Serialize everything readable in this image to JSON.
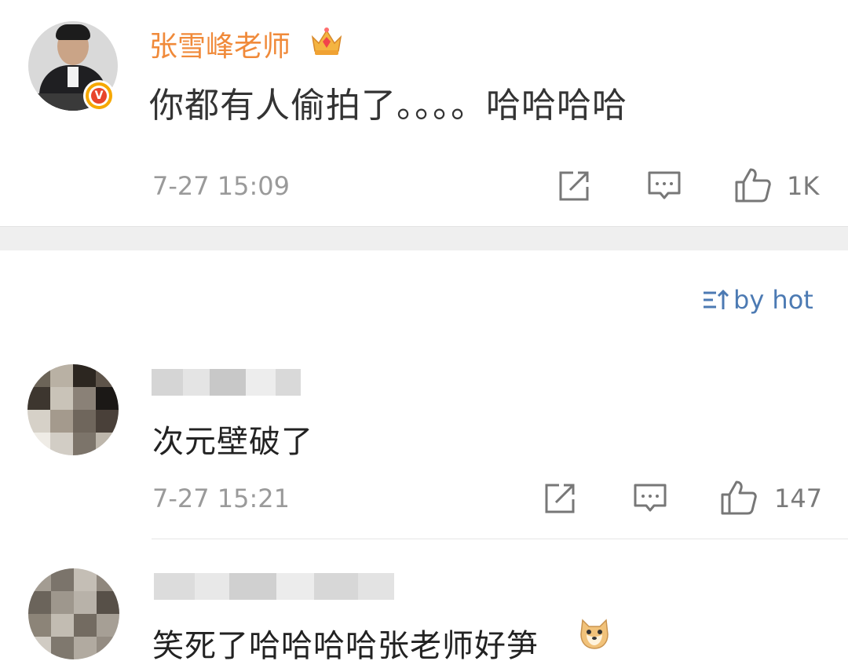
{
  "post": {
    "author": "张雪峰老师",
    "verified_badge_icon": "orange-v-badge-icon",
    "crown_icon": "crown-icon",
    "text": "你都有人偷拍了。。。。哈哈哈哈",
    "time": "7-27 15:09",
    "like_count": "1K"
  },
  "sort": {
    "label": "by hot",
    "icon": "sort-icon"
  },
  "comments": [
    {
      "author": "",
      "text": "次元壁破了",
      "time": "7-27 15:21",
      "like_count": "147"
    },
    {
      "author": "",
      "text": "笑死了哈哈哈哈张老师好笋",
      "emoji_icon": "doge-emoji-icon"
    }
  ],
  "colors": {
    "author_name": "#f08a3a",
    "sort_link": "#4c7ab3",
    "meta_gray": "#9a9a9a",
    "separator_band": "#efefef"
  }
}
